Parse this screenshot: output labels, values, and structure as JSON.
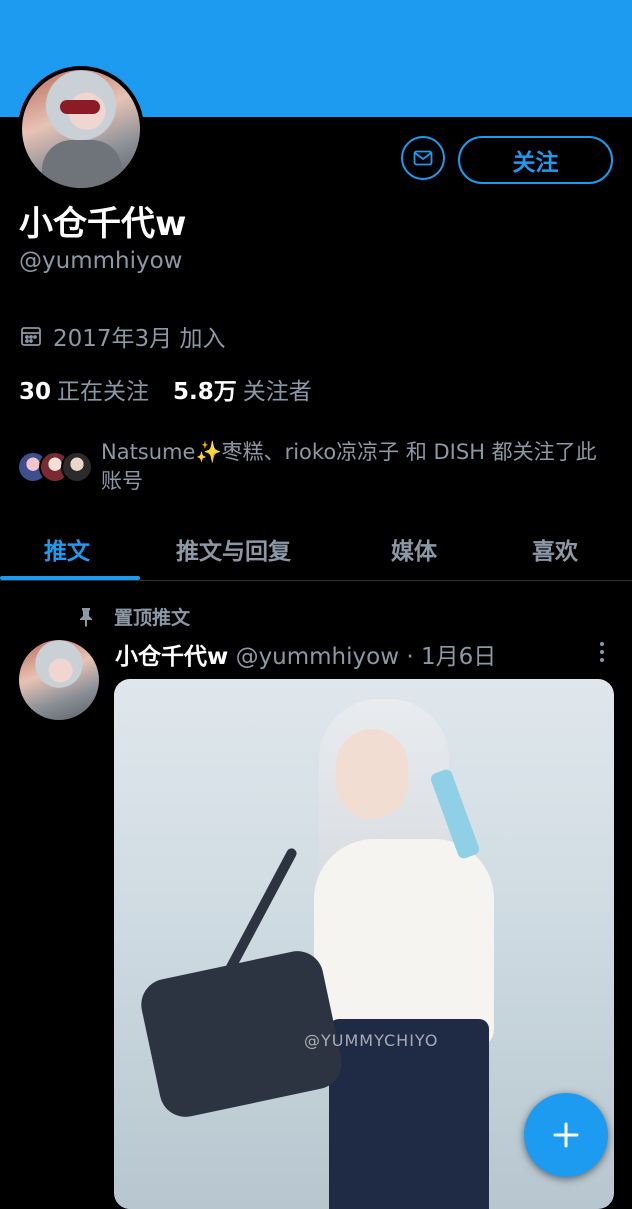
{
  "profile": {
    "display_name": "小仓千代w",
    "handle": "@yummhiyow",
    "joined": "2017年3月 加入",
    "following_count": "30",
    "following_label": "正在关注",
    "followers_count": "5.8万",
    "followers_label": "关注者",
    "followed_by_text": "Natsume✨枣糕、rioko凉凉子 和 DISH 都关注了此账号"
  },
  "actions": {
    "message_icon": "mail-icon",
    "follow_label": "关注"
  },
  "tabs": [
    {
      "label": "推文",
      "active": true
    },
    {
      "label": "推文与回复",
      "active": false
    },
    {
      "label": "媒体",
      "active": false
    },
    {
      "label": "喜欢",
      "active": false
    }
  ],
  "pinned_tweet": {
    "pinned_label": "置顶推文",
    "author_name": "小仓千代w",
    "author_handle": "@yummhiyow",
    "separator": "·",
    "date": "1月6日",
    "media_watermark": "@YUMMYCHIYO"
  },
  "fab": {
    "icon": "plus-icon"
  },
  "colors": {
    "accent": "#1d9bf0",
    "background": "#000000",
    "secondary_text": "#8b98a5"
  }
}
